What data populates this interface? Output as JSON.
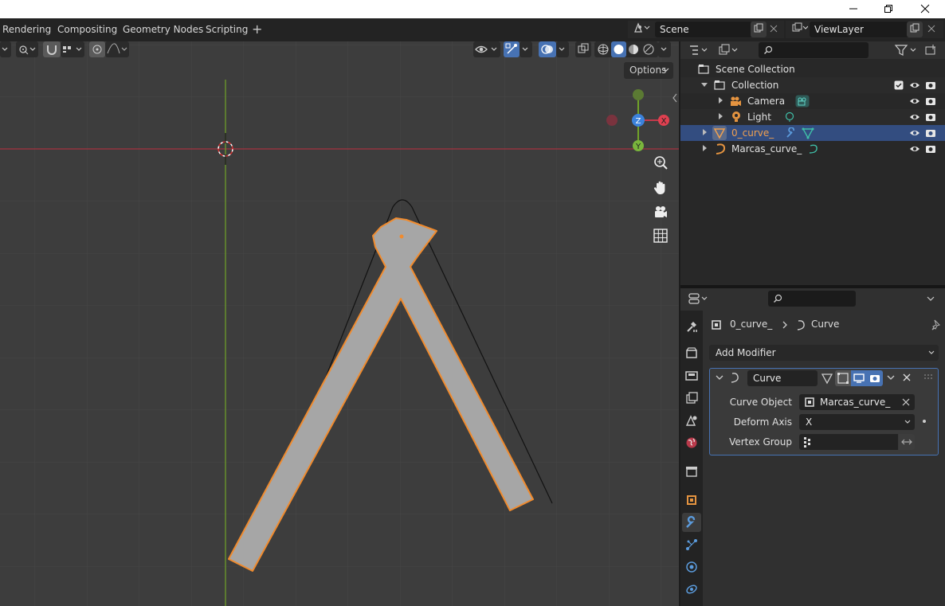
{
  "window": {
    "minimize": "–",
    "restore": "❐",
    "close": "✕"
  },
  "workspaces": {
    "tabs": [
      "Rendering",
      "Compositing",
      "Geometry Nodes",
      "Scripting"
    ],
    "add": "+"
  },
  "scene": {
    "name": "Scene"
  },
  "view_layer": {
    "name": "ViewLayer"
  },
  "viewport": {
    "options_label": "Options",
    "gizmo": {
      "x": "X",
      "y": "Y",
      "z": "Z"
    },
    "colors": {
      "background": "#3d3d3d",
      "grid": "#4a4a4a",
      "x_axis": "#a6333f",
      "y_axis": "#71a329",
      "selection": "#f08b2e",
      "mesh": "#a9a9a9"
    }
  },
  "outliner": {
    "search_placeholder": "",
    "items": [
      {
        "label": "Scene Collection",
        "icon": "scene-collection-icon"
      },
      {
        "label": "Collection",
        "icon": "collection-icon"
      },
      {
        "label": "Camera",
        "icon": "camera-icon"
      },
      {
        "label": "Light",
        "icon": "light-icon"
      },
      {
        "label": "0_curve_",
        "icon": "mesh-icon",
        "selected": true
      },
      {
        "label": "Marcas_curve_",
        "icon": "curve-icon"
      }
    ]
  },
  "properties": {
    "search_placeholder": "",
    "breadcrumb": {
      "object": "0_curve_",
      "modifier": "Curve"
    },
    "add_modifier": "Add Modifier",
    "modifier": {
      "name": "Curve",
      "curve_object_label": "Curve Object",
      "curve_object_value": "Marcas_curve_",
      "deform_axis_label": "Deform Axis",
      "deform_axis_value": "X",
      "vertex_group_label": "Vertex Group",
      "vertex_group_value": ""
    },
    "tabs": [
      "tool-icon",
      "render-icon",
      "output-icon",
      "view-layer-icon",
      "scene-icon",
      "world-icon",
      "collection-icon",
      "object-icon",
      "modifier-icon",
      "particles-icon",
      "physics-icon",
      "constraints-icon"
    ]
  }
}
